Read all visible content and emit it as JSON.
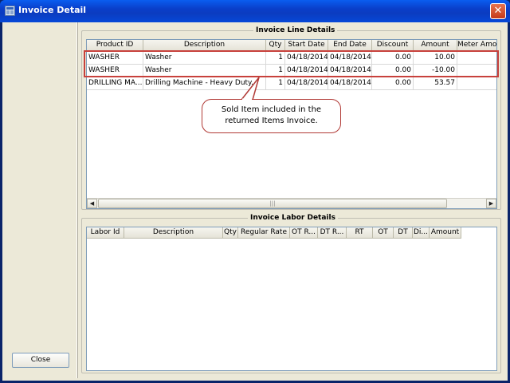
{
  "window": {
    "title": "Invoice Detail",
    "close_glyph": "✕"
  },
  "left": {
    "close_label": "Close"
  },
  "line_details": {
    "title": "Invoice Line Details",
    "columns": [
      "Product ID",
      "Description",
      "Qty",
      "Start Date",
      "End Date",
      "Discount",
      "Amount",
      "Meter Amou"
    ],
    "rows": [
      [
        "WASHER",
        "Washer",
        "1",
        "04/18/2014",
        "04/18/2014",
        "0.00",
        "10.00",
        ""
      ],
      [
        "WASHER",
        "Washer",
        "1",
        "04/18/2014",
        "04/18/2014",
        "0.00",
        "-10.00",
        ""
      ],
      [
        "DRILLING MA...",
        "Drilling Machine - Heavy Duty...",
        "1",
        "04/18/2014",
        "04/18/2014",
        "0.00",
        "53.57",
        ""
      ]
    ],
    "scroll_left": "◀",
    "scroll_right": "▶",
    "thumb_grip": "|||"
  },
  "callout": {
    "line1": "Sold Item included in the",
    "line2": "returned Items Invoice."
  },
  "labor_details": {
    "title": "Invoice Labor Details",
    "columns": [
      "Labor Id",
      "Description",
      "Qty",
      "Regular Rate",
      "OT R...",
      "DT R...",
      "RT",
      "OT",
      "DT",
      "Di...",
      "Amount"
    ]
  },
  "colors": {
    "titlebar": "#0a3ec9",
    "highlight": "#c8413c",
    "panel": "#ece9d8"
  },
  "icons": {
    "app_icon": "window-app-icon",
    "close": "close-icon"
  }
}
